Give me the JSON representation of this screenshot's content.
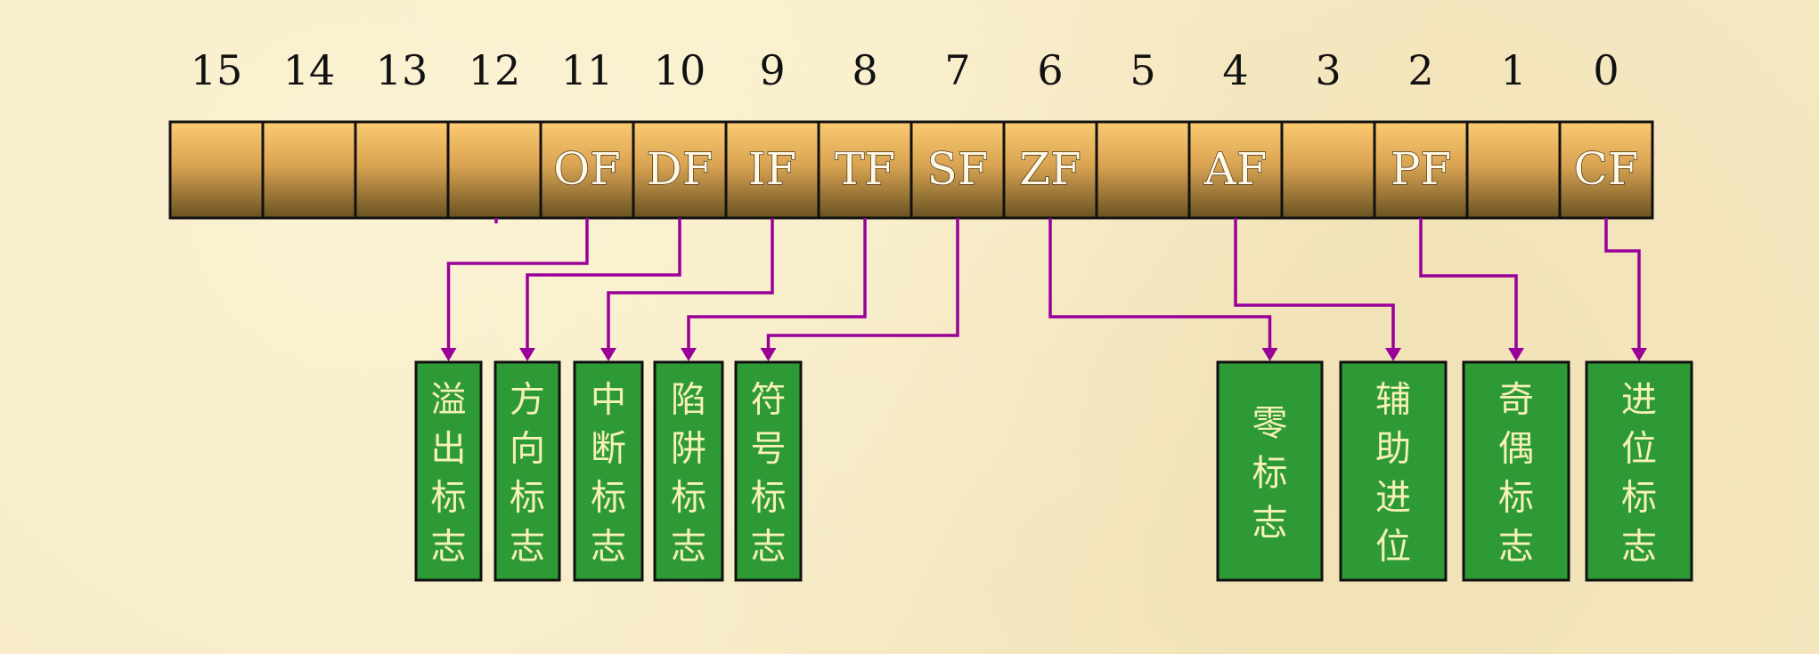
{
  "bits": [
    {
      "num": "15",
      "abbr": ""
    },
    {
      "num": "14",
      "abbr": ""
    },
    {
      "num": "13",
      "abbr": ""
    },
    {
      "num": "12",
      "abbr": ""
    },
    {
      "num": "11",
      "abbr": "OF"
    },
    {
      "num": "10",
      "abbr": "DF"
    },
    {
      "num": "9",
      "abbr": "IF"
    },
    {
      "num": "8",
      "abbr": "TF"
    },
    {
      "num": "7",
      "abbr": "SF"
    },
    {
      "num": "6",
      "abbr": "ZF"
    },
    {
      "num": "5",
      "abbr": ""
    },
    {
      "num": "4",
      "abbr": "AF"
    },
    {
      "num": "3",
      "abbr": ""
    },
    {
      "num": "2",
      "abbr": "PF"
    },
    {
      "num": "1",
      "abbr": ""
    },
    {
      "num": "0",
      "abbr": "CF"
    }
  ],
  "flag_boxes": [
    {
      "flag": "OF",
      "label": "溢出标志"
    },
    {
      "flag": "DF",
      "label": "方向标志"
    },
    {
      "flag": "IF",
      "label": "中断标志"
    },
    {
      "flag": "TF",
      "label": "陷阱标志"
    },
    {
      "flag": "SF",
      "label": "符号标志"
    },
    {
      "flag": "ZF",
      "label": "零标志"
    },
    {
      "flag": "AF",
      "label": "辅助进位"
    },
    {
      "flag": "PF",
      "label": "奇偶标志"
    },
    {
      "flag": "CF",
      "label": "进位标志"
    }
  ],
  "colors": {
    "background": "#f6e9c3",
    "cell_top": "#fdcb72",
    "cell_bottom": "#6a5222",
    "connector": "#990099",
    "box_fill": "#2e9a35",
    "box_text": "#f6f1b8"
  }
}
